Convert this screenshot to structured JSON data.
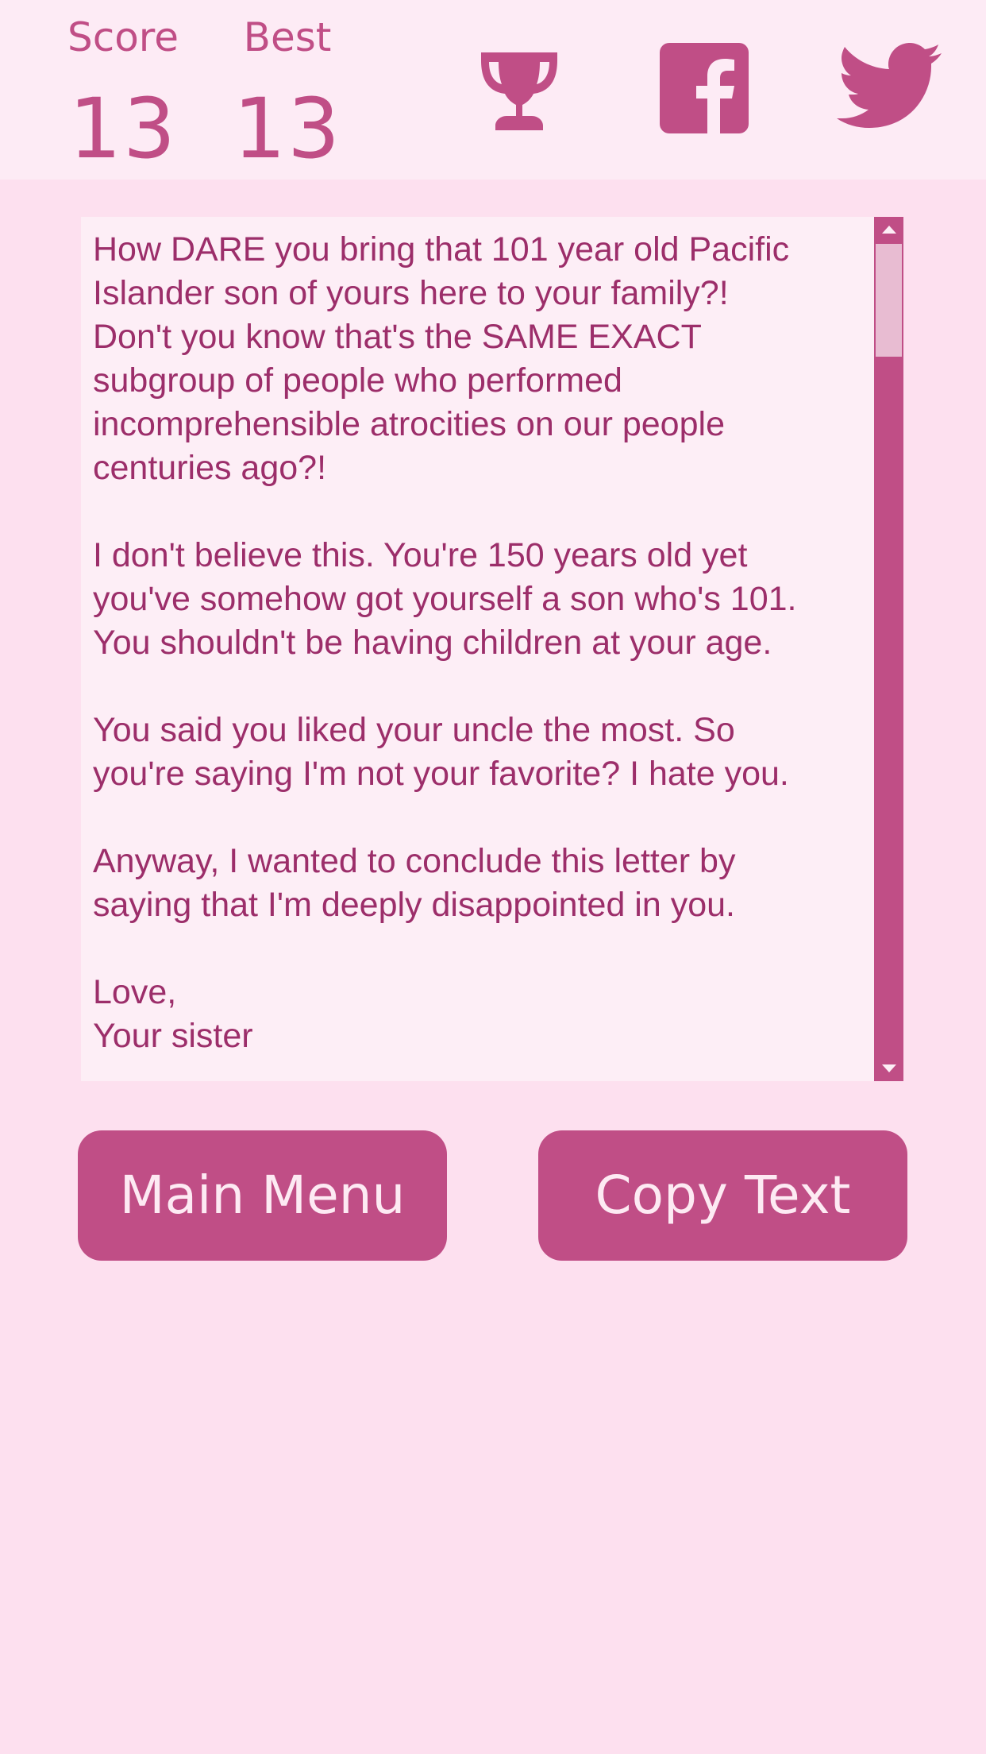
{
  "header": {
    "score_label": "Score",
    "score_value": "13",
    "best_label": "Best",
    "best_value": "13",
    "icons": [
      "trophy-icon",
      "facebook-icon",
      "twitter-icon"
    ]
  },
  "letter": {
    "text": "How DARE you bring that 101 year old Pacific\nIslander son of yours here to your family?!\nDon't you know that's the SAME EXACT\nsubgroup of people who performed\nincomprehensible atrocities on our people\ncenturies ago?!\n\nI don't believe this. You're 150 years old yet\nyou've somehow got yourself a son who's 101.\nYou shouldn't be having children at your age.\n\nYou said you liked your uncle the most. So\nyou're saying I'm not your favorite? I hate you.\n\nAnyway, I wanted to conclude this letter by\nsaying that I'm deeply disappointed in you.\n\nLove,\nYour sister"
  },
  "buttons": {
    "main_menu": "Main Menu",
    "copy_text": "Copy Text"
  },
  "colors": {
    "accent": "#c04e86",
    "background": "#fde0ef",
    "header_background": "#fdebf5",
    "text": "#9c2e6a"
  }
}
